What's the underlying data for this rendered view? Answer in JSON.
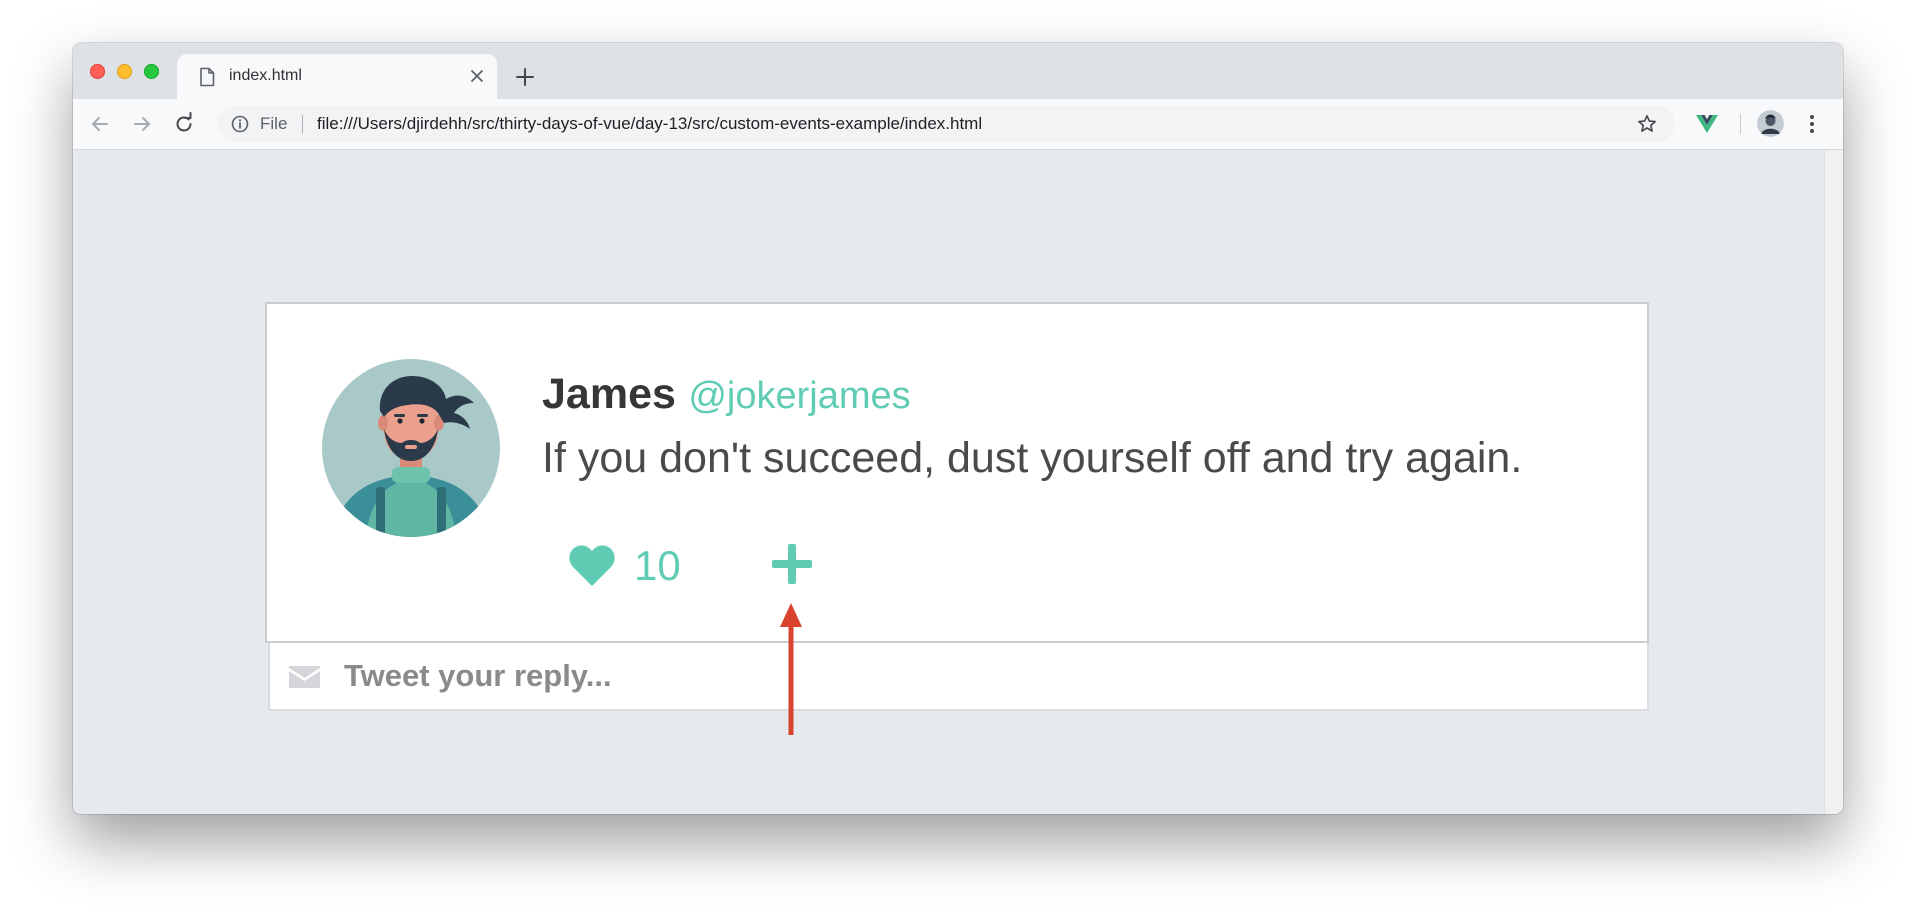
{
  "browser": {
    "tab": {
      "title": "index.html",
      "icon": "page-icon",
      "close_icon": "close-icon"
    },
    "new_tab_icon": "plus-icon",
    "toolbar": {
      "back_icon": "back-arrow-icon",
      "forward_icon": "forward-arrow-icon",
      "reload_icon": "reload-icon",
      "omnibox": {
        "info_icon": "info-icon",
        "scheme_label": "File",
        "url": "file:///Users/djirdehh/src/thirty-days-of-vue/day-13/src/custom-events-example/index.html",
        "bookmark_icon": "star-icon"
      },
      "extensions": [
        "vue-devtools-icon"
      ],
      "profile_icon": "profile-avatar",
      "menu_icon": "three-dot-menu-icon"
    }
  },
  "tweet": {
    "name": "James",
    "handle": "@jokerjames",
    "text": "If you don't succeed, dust yourself off and try again.",
    "likes": "10",
    "like_icon": "heart-icon",
    "add_icon": "plus-icon"
  },
  "reply": {
    "placeholder": "Tweet your reply...",
    "icon": "envelope-icon"
  },
  "colors": {
    "accent": "#5fccb3",
    "page_background": "#e6eaee",
    "annotation_arrow": "#d9432e",
    "name_text": "#363636",
    "tweet_text": "#4a4a4a"
  },
  "annotation": {
    "type": "arrow",
    "points_to": "add-icon"
  }
}
